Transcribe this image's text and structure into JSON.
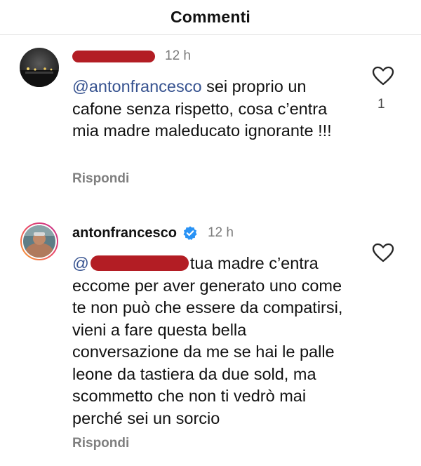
{
  "header": {
    "title": "Commenti"
  },
  "comments": [
    {
      "username": "",
      "time": "12 h",
      "mention": "@antonfrancesco",
      "text": " sei proprio un cafone senza rispetto, cosa c’entra mia madre maleducato ignorante !!!",
      "reply_label": "Rispondi",
      "like_count": "1",
      "avatar_icon": "night-scene-avatar"
    },
    {
      "username": "antonfrancesco",
      "verified": true,
      "time": "12 h",
      "mention": "@",
      "text": "tua madre c’entra eccome per aver generato uno come te non può che essere da compatirsi, vieni a fare questa bella conversazione da me se hai le palle leone da tastiera da due sold, ma scommetto che non ti vedrò mai perché sei un sorcio",
      "reply_label": "Rispondi",
      "avatar_icon": "gym-portrait-avatar"
    }
  ],
  "colors": {
    "mention": "#36528f",
    "verified": "#2a93f5",
    "redaction": "#b31d24",
    "story_ring_start": "#f7a22c",
    "story_ring_end": "#c02a8c"
  }
}
